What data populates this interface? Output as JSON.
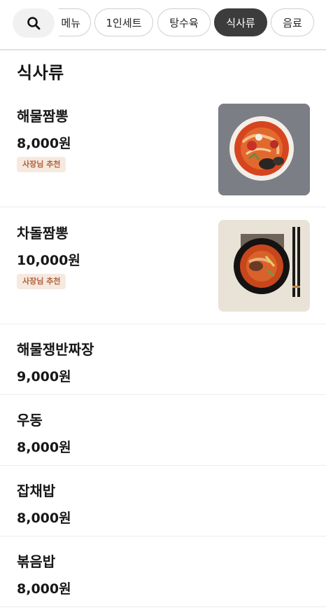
{
  "categories": [
    {
      "label": "메뉴",
      "selected": false
    },
    {
      "label": "1인세트",
      "selected": false
    },
    {
      "label": "탕수육",
      "selected": false
    },
    {
      "label": "식사류",
      "selected": true
    },
    {
      "label": "음료",
      "selected": false
    }
  ],
  "search": {
    "icon": "search-icon"
  },
  "section": {
    "title": "식사류"
  },
  "items": [
    {
      "name": "해물짬뽕",
      "price": "8,000원",
      "badge": "사장님 추천",
      "has_image": true
    },
    {
      "name": "차돌짬뽕",
      "price": "10,000원",
      "badge": "사장님 추천",
      "has_image": true
    },
    {
      "name": "해물쟁반짜장",
      "price": "9,000원"
    },
    {
      "name": "우동",
      "price": "8,000원"
    },
    {
      "name": "잡채밥",
      "price": "8,000원"
    },
    {
      "name": "볶음밥",
      "price": "8,000원"
    }
  ],
  "colors": {
    "selected_chip": "#3c3c3c",
    "badge_bg": "#f6e9df",
    "badge_text": "#b0613d"
  }
}
